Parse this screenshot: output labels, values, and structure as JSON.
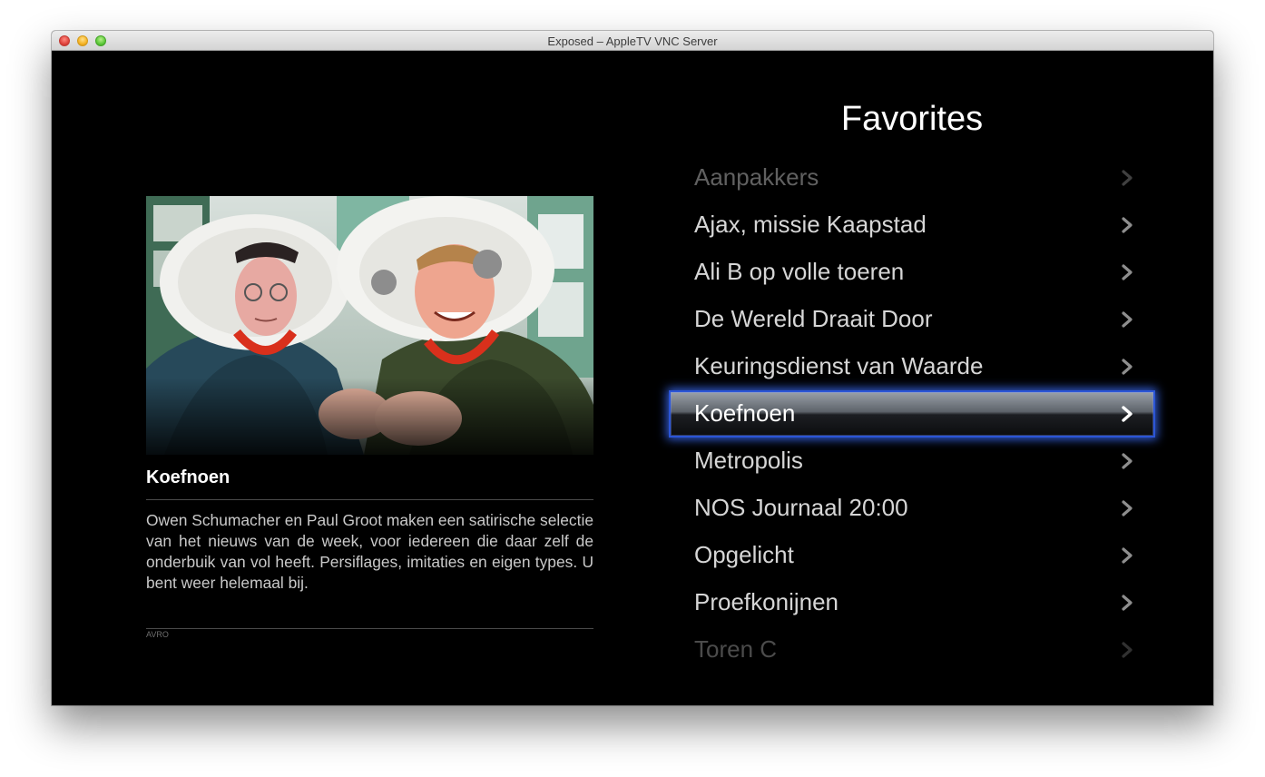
{
  "window": {
    "title": "Exposed – AppleTV VNC Server"
  },
  "preview": {
    "title": "Koefnoen",
    "description": "Owen Schumacher en Paul Groot maken een satirische selectie van het nieuws van de week, voor iedereen die daar zelf de onderbuik van vol heeft. Persiflages, imitaties en eigen types. U bent weer helemaal bij.",
    "network": "AVRO"
  },
  "menu": {
    "title": "Favorites",
    "selected_index": 5,
    "items": [
      {
        "label": "Aanpakkers"
      },
      {
        "label": "Ajax, missie Kaapstad"
      },
      {
        "label": "Ali B op volle toeren"
      },
      {
        "label": "De Wereld Draait Door"
      },
      {
        "label": "Keuringsdienst van Waarde"
      },
      {
        "label": "Koefnoen"
      },
      {
        "label": "Metropolis"
      },
      {
        "label": "NOS Journaal 20:00"
      },
      {
        "label": "Opgelicht"
      },
      {
        "label": "Proefkonijnen"
      },
      {
        "label": "Toren C"
      }
    ]
  },
  "colors": {
    "selection_border": "#2b55d6",
    "background": "#000000",
    "text": "#d6d6d6"
  },
  "icons": {
    "chevron": "chevron-right-icon"
  }
}
